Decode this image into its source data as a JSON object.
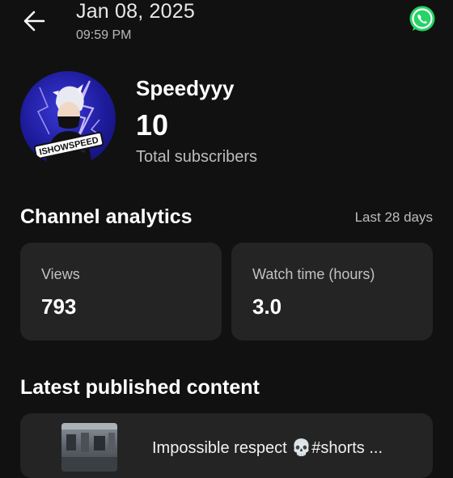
{
  "header": {
    "date": "Jan 08, 2025",
    "time": "09:59 PM",
    "back_icon": "arrow-left-icon",
    "share_icon": "whatsapp-icon",
    "share_color": "#25D366"
  },
  "channel": {
    "name": "Speedyyy",
    "subscribers": "10",
    "subscribers_label": "Total subscribers",
    "avatar_text": "ISHOWSPEED"
  },
  "analytics": {
    "title": "Channel analytics",
    "period": "Last 28 days",
    "cards": [
      {
        "label": "Views",
        "value": "793"
      },
      {
        "label": "Watch time (hours)",
        "value": "3.0"
      }
    ]
  },
  "latest": {
    "title": "Latest published content",
    "items": [
      {
        "title": "Impossible respect 💀#shorts ..."
      }
    ]
  },
  "colors": {
    "background": "#111111",
    "card": "#242424",
    "secondary_text": "#bdbdbd"
  }
}
